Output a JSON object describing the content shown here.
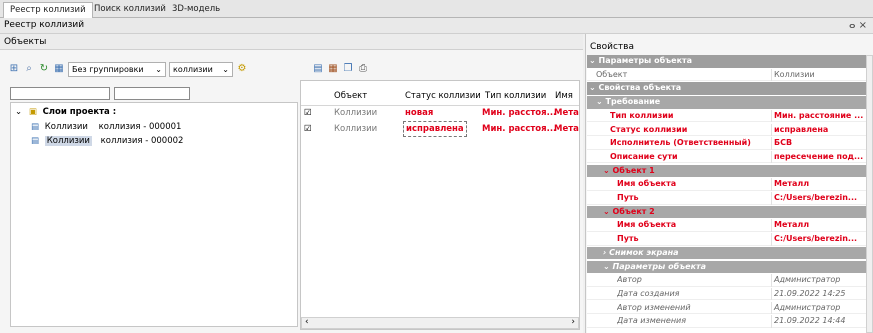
{
  "tabs": [
    "Реестр коллизий",
    "Поиск коллизий",
    "3D-модель"
  ],
  "window_title": "Реестр коллизий",
  "window_controls": "ⴰ ×",
  "objects_panel": {
    "title": "Объекты",
    "grouping_value": "Без группировки",
    "type_value": "коллизии",
    "tree": {
      "root": "Слои проекта :",
      "items": [
        {
          "type": "Коллизии",
          "name": "коллизия - 000001"
        },
        {
          "type": "Коллизии",
          "name": "коллизия - 000002"
        }
      ]
    }
  },
  "grid": {
    "columns": [
      "Объект",
      "Статус коллизии",
      "Тип коллизии",
      "Имя"
    ],
    "rows": [
      {
        "object": "Коллизии",
        "status": "новая",
        "type": "Мин. расстоя...",
        "name": "Мета"
      },
      {
        "object": "Коллизии",
        "status": "исправлена",
        "type": "Мин. расстоя...",
        "name": "Мета"
      }
    ]
  },
  "properties": {
    "title": "Свойства",
    "rows": [
      {
        "kind": "cat",
        "name": "Параметры объекта",
        "value": "",
        "indent": 0,
        "arrow": "v"
      },
      {
        "kind": "plain",
        "name": "Объект",
        "value": "Коллизии",
        "indent": 1
      },
      {
        "kind": "cat",
        "name": "Свойства объекта",
        "value": "",
        "indent": 0,
        "arrow": "v"
      },
      {
        "kind": "subcat",
        "name": "Требование",
        "value": "",
        "indent": 1,
        "arrow": "v"
      },
      {
        "kind": "red",
        "name": "Тип коллизии",
        "value": "Мин. расстояние ...",
        "indent": 3
      },
      {
        "kind": "red",
        "name": "Статус коллизии",
        "value": "исправлена",
        "indent": 3
      },
      {
        "kind": "red",
        "name": "Исполнитель (Ответственный)",
        "value": "БСВ",
        "indent": 3
      },
      {
        "kind": "red",
        "name": "Описание сути",
        "value": "пересечение под...",
        "indent": 3
      },
      {
        "kind": "redcat",
        "name": "Объект 1",
        "value": "",
        "indent": 2,
        "arrow": "v"
      },
      {
        "kind": "red",
        "name": "Имя объекта",
        "value": "Металл",
        "indent": 4
      },
      {
        "kind": "red",
        "name": "Путь",
        "value": "C:/Users/berezin...",
        "indent": 4
      },
      {
        "kind": "redcat",
        "name": "Объект 2",
        "value": "",
        "indent": 2,
        "arrow": "v"
      },
      {
        "kind": "red",
        "name": "Имя объекта",
        "value": "Металл",
        "indent": 4
      },
      {
        "kind": "red",
        "name": "Путь",
        "value": "C:/Users/berezin...",
        "indent": 4
      },
      {
        "kind": "italcat",
        "name": "Снимок экрана",
        "value": "",
        "indent": 2,
        "arrow": ">"
      },
      {
        "kind": "italcat",
        "name": "Параметры объекта",
        "value": "",
        "indent": 2,
        "arrow": "v"
      },
      {
        "kind": "ital",
        "name": "Автор",
        "value": "Администратор",
        "indent": 4
      },
      {
        "kind": "ital",
        "name": "Дата создания",
        "value": "21.09.2022 14:25",
        "indent": 4
      },
      {
        "kind": "ital",
        "name": "Автор изменений",
        "value": "Администратор",
        "indent": 4
      },
      {
        "kind": "ital",
        "name": "Дата изменения",
        "value": "21.09.2022 14:44",
        "indent": 4
      }
    ]
  },
  "colors": {
    "accent_red": "#e0001a",
    "category_grey": "#9e9e9e"
  }
}
